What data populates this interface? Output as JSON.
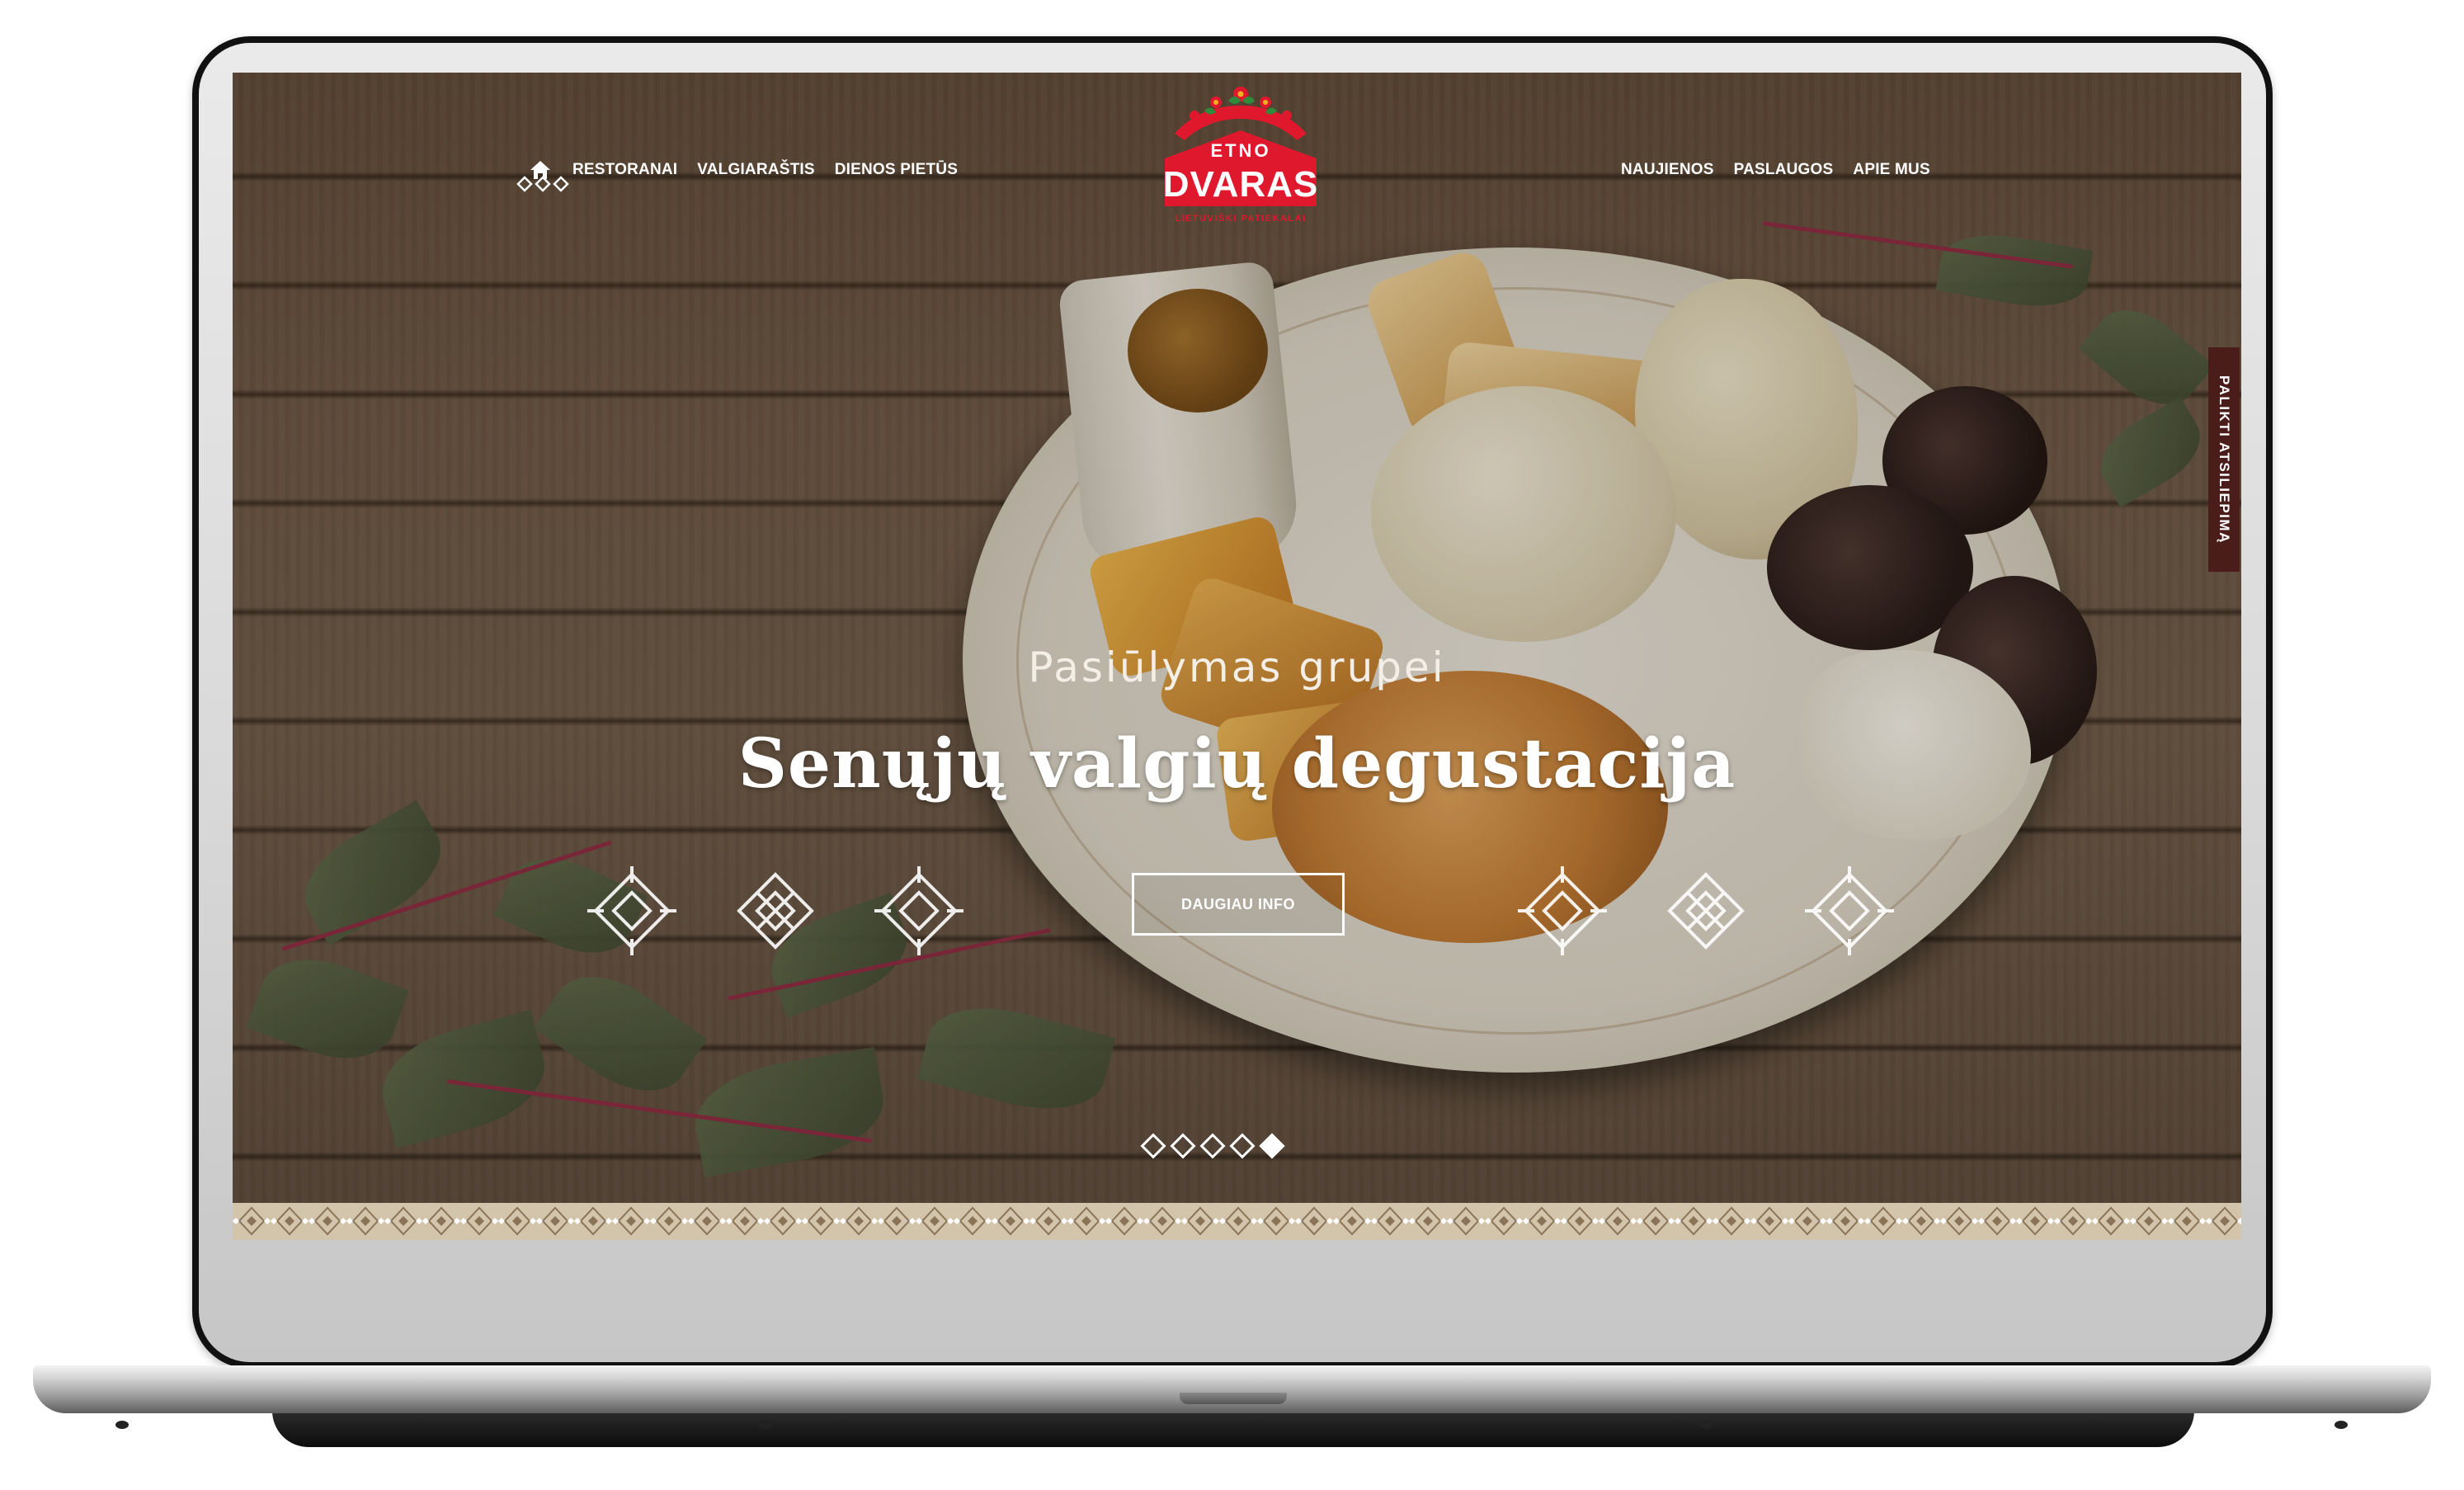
{
  "nav": {
    "left": [
      "RESTORANAI",
      "VALGIARAŠTIS",
      "DIENOS PIETŪS"
    ],
    "right": [
      "NAUJIENOS",
      "PASLAUGOS",
      "APIE MUS"
    ]
  },
  "logo": {
    "top": "ETNO",
    "main": "DVARAS",
    "tagline": "LIETUVIŠKI PATIEKALAI"
  },
  "hero": {
    "kicker": "Pasiūlymas grupei",
    "title": "Senųjų valgių degustacija",
    "cta": "DAUGIAU INFO"
  },
  "slider": {
    "count": 5,
    "active_index": 4
  },
  "side_tab": {
    "label": "PALIKTI ATSILIEPIMĄ"
  },
  "colors": {
    "brand_red": "#e0182d",
    "side_tab": "#4a1d1b",
    "pattern": "#d3c4ac"
  },
  "icons": [
    "home-icon",
    "diamond-ornament-icon",
    "folk-star-ornament-icon",
    "slider-dot"
  ]
}
